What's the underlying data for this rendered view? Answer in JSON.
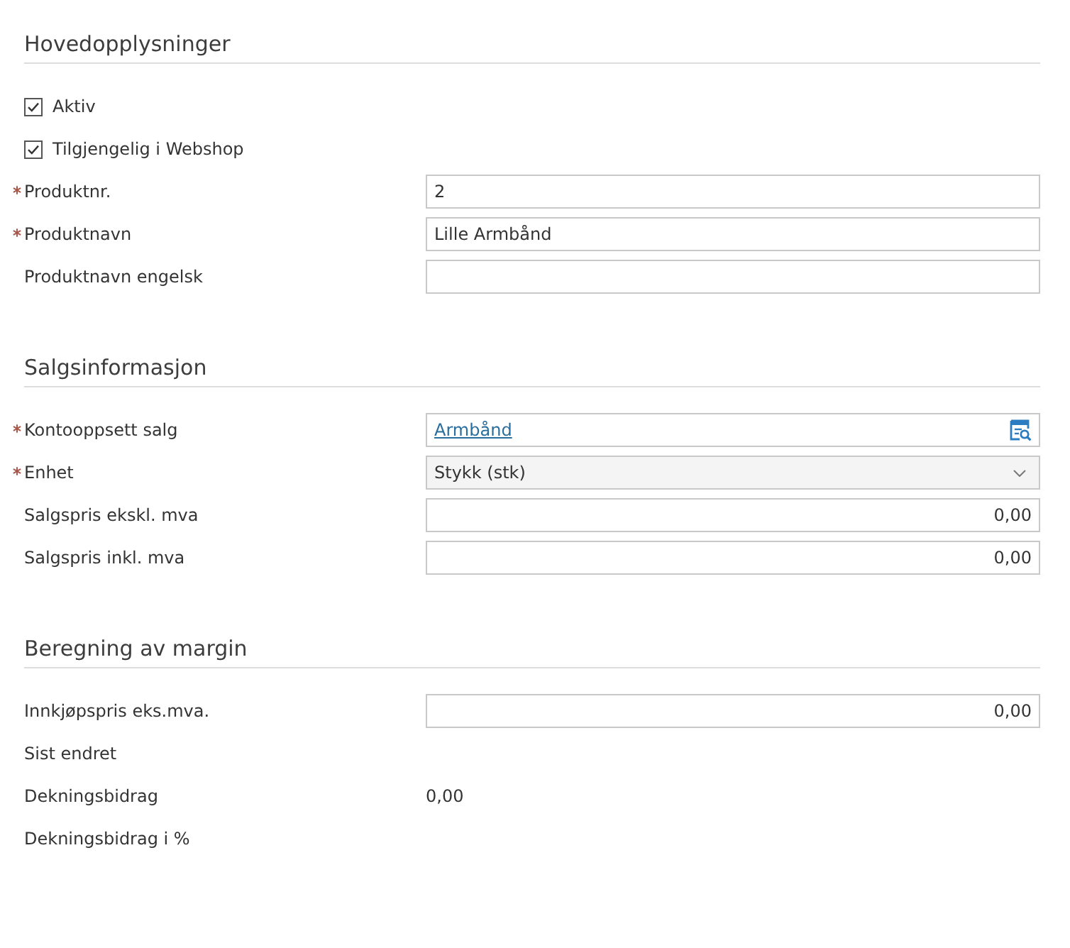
{
  "sections": [
    {
      "title": "Hovedopplysninger",
      "rows": [
        {
          "kind": "checkbox",
          "label": "Aktiv",
          "checked": true
        },
        {
          "kind": "checkbox",
          "label": "Tilgjengelig i Webshop",
          "checked": true
        },
        {
          "kind": "text",
          "label": "Produktnr.",
          "required": true,
          "value": "2"
        },
        {
          "kind": "text",
          "label": "Produktnavn",
          "required": true,
          "value": "Lille Armbånd"
        },
        {
          "kind": "text",
          "label": "Produktnavn engelsk",
          "required": false
        }
      ]
    },
    {
      "title": "Salgsinformasjon",
      "rows": [
        {
          "kind": "lookup",
          "label": "Kontooppsett salg",
          "required": true,
          "value": "Armbånd"
        },
        {
          "kind": "select",
          "label": "Enhet",
          "required": true,
          "value": "Stykk (stk)"
        },
        {
          "kind": "number",
          "label": "Salgspris ekskl. mva",
          "required": false,
          "value": "0,00"
        },
        {
          "kind": "number",
          "label": "Salgspris inkl. mva",
          "required": false,
          "value": "0,00"
        }
      ]
    },
    {
      "title": "Beregning av margin",
      "rows": [
        {
          "kind": "number",
          "label": "Innkjøpspris eks.mva.",
          "required": false,
          "value": "0,00"
        },
        {
          "kind": "readonly",
          "label": "Sist endret",
          "required": false
        },
        {
          "kind": "readonly",
          "label": "Dekningsbidrag",
          "required": false,
          "value": "0,00"
        },
        {
          "kind": "readonly",
          "label": "Dekningsbidrag i %",
          "required": false
        }
      ]
    }
  ]
}
